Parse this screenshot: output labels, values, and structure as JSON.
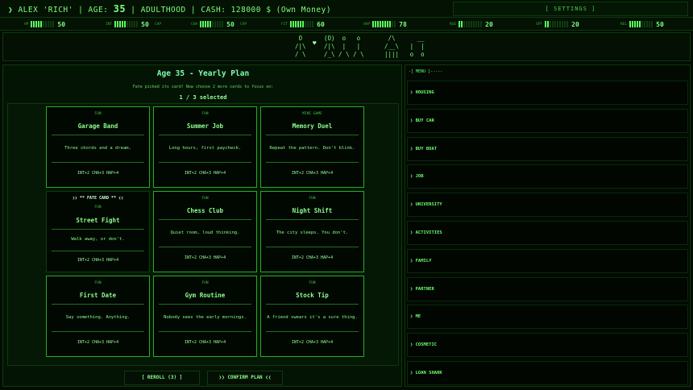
{
  "header": {
    "info": "❯ ALEX 'RICH' | AGE: ",
    "age": "35",
    "info_rest": " | ADULTHOOD | CASH: 128000 $ (Own Money)",
    "settings_label": "[ SETTINGS ]"
  },
  "stats": [
    {
      "label": "HP",
      "value": "50",
      "level": 5
    },
    {
      "label": "INT",
      "value": "50",
      "level": 5
    },
    {
      "label": "CAP",
      "value": "",
      "level": 0
    },
    {
      "label": "CHA",
      "value": "50",
      "level": 5
    },
    {
      "label": "CAP",
      "value": "",
      "level": 0
    },
    {
      "label": "FIT",
      "value": "60",
      "level": 6
    },
    {
      "label": "HAP",
      "value": "78",
      "level": 8
    },
    {
      "label": "RUS",
      "value": "20",
      "level": 2
    },
    {
      "label": "SPT",
      "value": "20",
      "level": 2
    },
    {
      "label": "REL",
      "value": "50",
      "level": 5
    }
  ],
  "scene": {
    "fig1": " O\n/|\\\n/ \\",
    "heart": "♥",
    "fig2": "(O)  o   o\n/|\\  |   |\n/_\\ / \\ / \\",
    "fig3": " /\\      __\n/__\\   |  |\n||||   o  o"
  },
  "plan": {
    "title": "Age 35 - Yearly Plan",
    "subtitle": "Fate picked its card! Now choose 2 more cards to focus on:",
    "counter": "1 / 3 selected",
    "reroll_label": "[ REROLL (3) ]",
    "confirm_label": "❯❯ CONFIRM PLAN ❮❮"
  },
  "cards": [
    {
      "tag": "FUN",
      "name": "Garage Band",
      "desc": "Three chords and a dream.",
      "stats": "INT+2  CHA+3  HAP+4"
    },
    {
      "tag": "FUN",
      "name": "Summer Job",
      "desc": "Long hours, first paycheck.",
      "stats": "INT+2  CHA+3  HAP+4"
    },
    {
      "tag": "MINI GAME",
      "name": "Memory Duel",
      "desc": "Repeat the pattern. Don't blink.",
      "stats": "INT+2  CHA+3  HAP+4"
    },
    {
      "fate_label": "❯❯ ** FATE CARD ** ❮❮",
      "tag": "FUN",
      "name": "Street Fight",
      "desc": "Walk away, or don't.",
      "stats": "INT+2  CHA+3  HAP+4"
    },
    {
      "tag": "FUN",
      "name": "Chess Club",
      "desc": "Quiet room, loud thinking.",
      "stats": "INT+2  CHA+3  HAP+4"
    },
    {
      "tag": "FUN",
      "name": "Night Shift",
      "desc": "The city sleeps. You don't.",
      "stats": "INT+2  CHA+3  HAP+4"
    },
    {
      "tag": "FUN",
      "name": "First Date",
      "desc": "Say something. Anything.",
      "stats": "INT+2  CHA+3  HAP+4"
    },
    {
      "tag": "FUN",
      "name": "Gym Routine",
      "desc": "Nobody sees the early mornings.",
      "stats": "INT+2  CHA+3  HAP+4"
    },
    {
      "tag": "FUN",
      "name": "Stock Tip",
      "desc": "A friend swears it's a sure thing.",
      "stats": "INT+2  CHA+3  HAP+4"
    }
  ],
  "menu": {
    "header": "-[ MENU ]-----",
    "items": [
      "❯ HOUSING",
      "❯ BUY CAR",
      "❯ BUY BOAT",
      "❯ JOB",
      "❯ UNIVERSITY",
      "❯ ACTIVITIES",
      "❯ FAMILY",
      "❯ PARTNER",
      "❯ ME",
      "❯ COSMETIC",
      "❯ LOAN SHARK"
    ]
  }
}
